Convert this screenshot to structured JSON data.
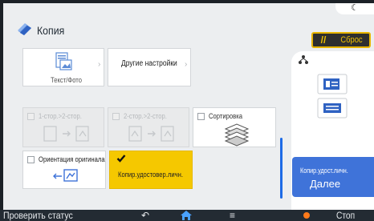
{
  "header": {
    "night_icon": "crescent-moon-icon",
    "title": "Копия",
    "title_icon": "copy-document-icon",
    "reset_icon": "reset-slash-icon",
    "reset_label": "Сброс"
  },
  "tiles": {
    "text_photo": {
      "label": "Текст/Фото",
      "icon": "document-text-photo-icon"
    },
    "other_settings": {
      "label": "Другие настройки"
    },
    "duplex_1_2": {
      "label": "1-стор.>2-стор.",
      "icon": "simplex-to-duplex-icon",
      "enabled": false
    },
    "duplex_2_2": {
      "label": "2-стор.>2-стор.",
      "icon": "duplex-to-duplex-icon",
      "enabled": false
    },
    "sort": {
      "label": "Сортировка",
      "icon": "sort-stack-icon",
      "checked": false
    },
    "orientation": {
      "label": "Ориентация оригинала",
      "icon": "orientation-icon",
      "checked": false
    },
    "id_copy": {
      "label": "Копир.удостовер.личн.",
      "checked": true
    }
  },
  "right_panel": {
    "icons": [
      "settings-tree-icon",
      "id-card-icon",
      "list-card-icon"
    ],
    "next_small": "Копир.удост.личн.",
    "next_label": "Далее"
  },
  "bottom_bar": {
    "status": "Проверить статус",
    "back_icon": "back-arrow-icon",
    "home_icon": "home-icon",
    "menu_icon": "menu-icon",
    "stop_icon": "stop-icon",
    "stop": "Стоп"
  },
  "colors": {
    "accent": "#f5c800",
    "primary": "#3f73d9",
    "bar": "#232b33"
  }
}
